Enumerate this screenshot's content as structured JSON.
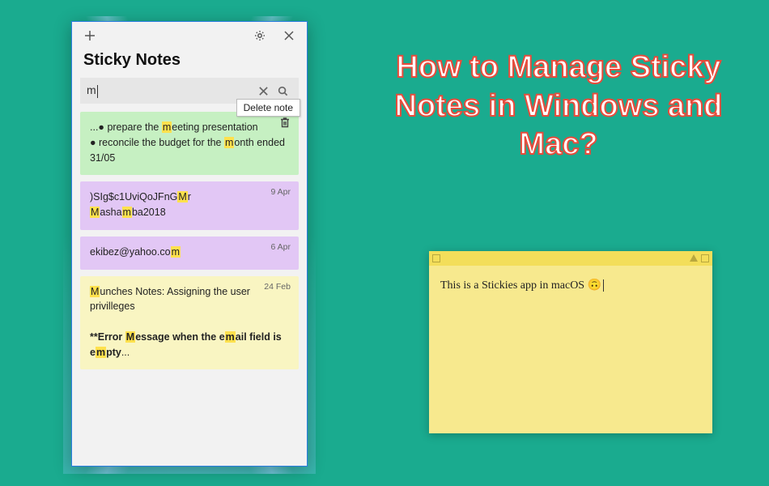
{
  "article": {
    "title": "How to Manage Sticky Notes in Windows and Mac?"
  },
  "win": {
    "heading": "Sticky Notes",
    "search": {
      "value": "m"
    },
    "tooltip": "Delete note",
    "notes": [
      {
        "color": "green",
        "date": "",
        "segments": [
          {
            "t": "...● prepare the "
          },
          {
            "t": "m",
            "hl": true
          },
          {
            "t": "eeting presentation"
          },
          {
            "br": true
          },
          {
            "t": "● reconcile the budget for the "
          },
          {
            "t": "m",
            "hl": true
          },
          {
            "t": "onth ended 31/05"
          }
        ],
        "showTrash": true
      },
      {
        "color": "purple",
        "date": "9 Apr",
        "segments": [
          {
            "t": ")SIg$c1UviQoJFnG"
          },
          {
            "t": "M",
            "hl": true
          },
          {
            "t": "r"
          },
          {
            "br": true
          },
          {
            "t": "M",
            "hl": true
          },
          {
            "t": "asha"
          },
          {
            "t": "m",
            "hl": true
          },
          {
            "t": "ba2018"
          }
        ]
      },
      {
        "color": "purple",
        "date": "6 Apr",
        "segments": [
          {
            "t": "ekibez@yahoo.co"
          },
          {
            "t": "m",
            "hl": true
          }
        ]
      },
      {
        "color": "yellow",
        "date": "24 Feb",
        "segments": [
          {
            "t": "M",
            "hl": true
          },
          {
            "t": "unches Notes: Assigning the user privilleges"
          },
          {
            "br": true
          },
          {
            "br": true
          },
          {
            "t": "**Error ",
            "bold": true
          },
          {
            "t": "M",
            "hl": true,
            "bold": true
          },
          {
            "t": "essage when the e",
            "bold": true
          },
          {
            "t": "m",
            "hl": true,
            "bold": true
          },
          {
            "t": "ail field is e",
            "bold": true
          },
          {
            "t": "m",
            "hl": true,
            "bold": true
          },
          {
            "t": "pty",
            "bold": true
          },
          {
            "t": "..."
          }
        ]
      }
    ]
  },
  "mac": {
    "text": "This is a Stickies app in macOS 🙃"
  }
}
